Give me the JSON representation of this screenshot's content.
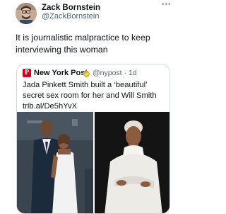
{
  "tweet": {
    "author_name": "Zack Bornstein",
    "author_handle": "@ZackBornstein",
    "text": "It is journalistic malpractice to keep interviewing this woman"
  },
  "quote": {
    "author_name": "New York Post",
    "logo_letter": "P",
    "meta": "@nypost · 1d",
    "text": "Jada Pinkett Smith built a ‘beautiful’ secret sex room for her and Will Smith trib.al/De5hYvX"
  },
  "colors": {
    "brand_red": "#d0021b",
    "verified_gold": "#e2b719",
    "secondary_text": "#536471",
    "border": "#cfd9de"
  },
  "icons": {
    "more": "more-icon",
    "verified": "verified-badge-icon"
  }
}
